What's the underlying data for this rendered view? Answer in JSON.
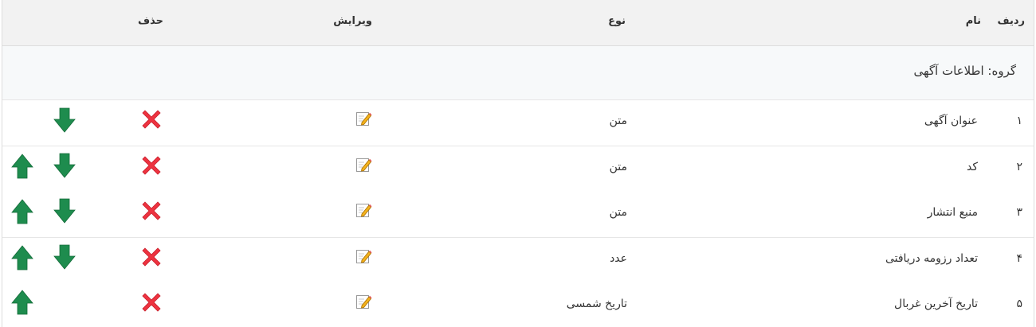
{
  "header": {
    "col_row": "ردیف",
    "col_name": "نام",
    "col_type": "نوع",
    "col_edit": "ویرایش",
    "col_delete": "حذف"
  },
  "group": {
    "label": "گروه: اطلاعات آگهی"
  },
  "rows": [
    {
      "index": "۱",
      "name": "عنوان آگهی",
      "type": "متن",
      "can_move_up": false,
      "can_move_down": true
    },
    {
      "index": "۲",
      "name": "کد",
      "type": "متن",
      "can_move_up": true,
      "can_move_down": true
    },
    {
      "index": "۳",
      "name": "منبع انتشار",
      "type": "متن",
      "can_move_up": true,
      "can_move_down": true
    },
    {
      "index": "۴",
      "name": "تعداد رزومه دریافتی",
      "type": "عدد",
      "can_move_up": true,
      "can_move_down": true
    },
    {
      "index": "۵",
      "name": "تاریخ آخرین غربال",
      "type": "تاریخ شمسی",
      "can_move_up": true,
      "can_move_down": false
    }
  ],
  "colors": {
    "delete": "#ee3340",
    "arrow": "#1e8c4e",
    "header_bg": "#f2f2f2",
    "group_bg": "#f7f9fa"
  },
  "icons": {
    "delete": "close-x-icon",
    "edit": "pencil-edit-icon",
    "up": "arrow-up-icon",
    "down": "arrow-down-icon"
  }
}
